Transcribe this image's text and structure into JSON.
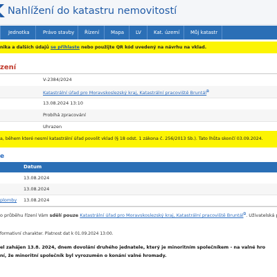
{
  "header": {
    "logo_glyph": "K",
    "title": "Nahlížení do katastru nemovitostí"
  },
  "nav": {
    "items": [
      "Jednotka",
      "Právo stavby",
      "Řízení",
      "Mapa",
      "LV",
      "Kat. území",
      "Můj katastr"
    ]
  },
  "notice1": {
    "before": "nika a dalších údajů",
    "link": "se přihlaste",
    "after": "nebo použijte QR kód uvedený na návrhu na vklad."
  },
  "section1": {
    "title": "zení"
  },
  "details": [
    {
      "value": "V-2384/2024",
      "link": false
    },
    {
      "value": "Katastrální úřad pro Moravskoslezský kraj, Katastrální pracoviště Bruntál",
      "link": true,
      "ext": "⧉"
    },
    {
      "value": "13.08.2024 13:10",
      "link": false
    },
    {
      "value": "Probíhá zpracování",
      "link": false
    },
    {
      "value": "Uhrazen",
      "link": false
    }
  ],
  "notice2": {
    "text": "a, během které nesmí katastrální úřad povolit vklad (§ 18 odst. 1 zákona č. 256/2013 Sb.). Tato lhůta skončí 03.09.2024."
  },
  "section2": {
    "title": "e"
  },
  "table": {
    "date_header": "Datum",
    "rows": [
      {
        "label": "",
        "date": "13.08.2024"
      },
      {
        "label": "",
        "date": "13.08.2024"
      },
      {
        "label": "plomby",
        "date": "13.08.2024"
      }
    ]
  },
  "info": {
    "p1": "o průběhu řízení Vám",
    "p2": "sdělí pouze",
    "link": "Katastrální úřad pro Moravskoslezský kraj, Katastrální pracoviště Bruntál",
    "p3": ". Uživatelská p"
  },
  "footer": {
    "text": "formativní charakter. Platnost dat k 01.09.2024 13:00."
  },
  "bold_notes": [
    "el zahájen 13.8. 2024, dnem dovolání druhého jednatele, který je minoritním společníkem - na valné hro",
    "ní, že minoritní společník byl vyrozuměn o konání valné hromady."
  ],
  "colors": {
    "nav": "#2b6fb6",
    "notice": "#fcf403",
    "accent_red": "#c0392b",
    "link": "#2a6bbf"
  }
}
